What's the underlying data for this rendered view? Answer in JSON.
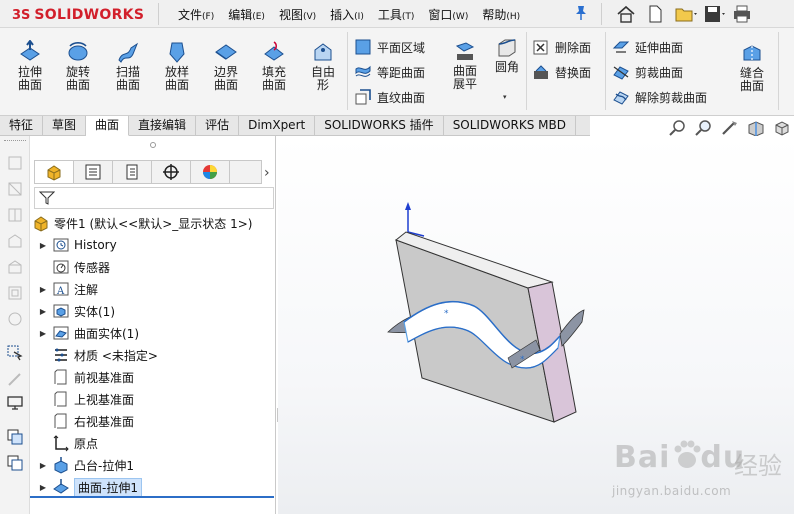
{
  "app": {
    "brand_prefix": "3S",
    "brand_name": "SOLIDWORKS"
  },
  "menu": [
    {
      "label": "文件",
      "key": "(F)"
    },
    {
      "label": "编辑",
      "key": "(E)"
    },
    {
      "label": "视图",
      "key": "(V)"
    },
    {
      "label": "插入",
      "key": "(I)"
    },
    {
      "label": "工具",
      "key": "(T)"
    },
    {
      "label": "窗口",
      "key": "(W)"
    },
    {
      "label": "帮助",
      "key": "(H)"
    }
  ],
  "quick_access_icons": [
    "home-icon",
    "new-document-icon",
    "open-icon",
    "save-icon",
    "print-icon"
  ],
  "ribbon": {
    "big_buttons": [
      {
        "label": "拉伸曲面"
      },
      {
        "label": "旋转曲面"
      },
      {
        "label": "扫描曲面"
      },
      {
        "label": "放样曲面"
      },
      {
        "label": "边界曲面"
      },
      {
        "label": "填充曲面"
      },
      {
        "label": "自由形"
      }
    ],
    "group2": [
      "平面区域",
      "等距曲面",
      "直纹曲面"
    ],
    "flatten": "曲面展平",
    "fillet": "圆角",
    "group3": [
      "删除面",
      "替换面"
    ],
    "group4": [
      "延伸曲面",
      "剪裁曲面",
      "解除剪裁曲面"
    ],
    "knit": "缝合曲面"
  },
  "tabs": [
    {
      "label": "特征"
    },
    {
      "label": "草图"
    },
    {
      "label": "曲面",
      "active": true
    },
    {
      "label": "直接编辑"
    },
    {
      "label": "评估"
    },
    {
      "label": "DimXpert"
    },
    {
      "label": "SOLIDWORKS 插件"
    },
    {
      "label": "SOLIDWORKS MBD"
    }
  ],
  "feature_tree": {
    "root": "零件1  (默认<<默认>_显示状态 1>)",
    "items": [
      {
        "label": "History",
        "expandable": true,
        "icon": "history-folder-icon"
      },
      {
        "label": "传感器",
        "expandable": false,
        "icon": "sensor-icon"
      },
      {
        "label": "注解",
        "expandable": true,
        "icon": "annotation-icon"
      },
      {
        "label": "实体(1)",
        "expandable": true,
        "icon": "solid-bodies-icon"
      },
      {
        "label": "曲面实体(1)",
        "expandable": true,
        "icon": "surface-bodies-icon"
      },
      {
        "label": "材质 <未指定>",
        "expandable": false,
        "icon": "material-icon"
      },
      {
        "label": "前视基准面",
        "expandable": false,
        "icon": "plane-icon"
      },
      {
        "label": "上视基准面",
        "expandable": false,
        "icon": "plane-icon"
      },
      {
        "label": "右视基准面",
        "expandable": false,
        "icon": "plane-icon"
      },
      {
        "label": "原点",
        "expandable": false,
        "icon": "origin-icon"
      },
      {
        "label": "凸台-拉伸1",
        "expandable": true,
        "icon": "boss-extrude-icon"
      },
      {
        "label": "曲面-拉伸1",
        "expandable": true,
        "icon": "surface-extrude-icon",
        "selected": true
      }
    ]
  },
  "watermark": {
    "brand": "Bai",
    "brand2": "du",
    "cn": "经验",
    "url": "jingyan.baidu.com"
  },
  "colors": {
    "brand_red": "#d21f2b",
    "selection_blue": "#2c6ec7",
    "surface_blue": "#5aa0e6"
  }
}
